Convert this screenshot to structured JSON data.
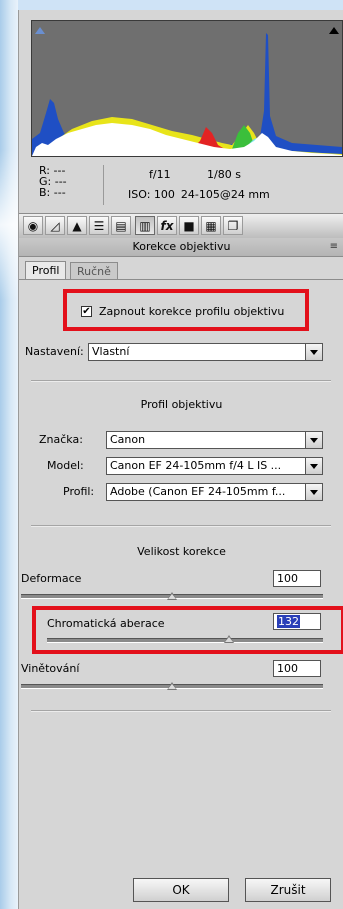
{
  "histogram": {
    "clip_shadow_icon": "triangle-up-icon",
    "clip_highlight_icon": "triangle-up-icon"
  },
  "info": {
    "r": "R:  ---",
    "g": "G:  ---",
    "b": "B:  ---",
    "aperture": "f/11",
    "shutter": "1/80 s",
    "iso": "ISO: 100",
    "lens": "24-105@24 mm"
  },
  "toolbar": {
    "tools": [
      "basic-icon",
      "tone-curve-icon",
      "detail-icon",
      "hsl-icon",
      "split-toning-icon",
      "lens-corrections-icon",
      "effects-icon",
      "camera-calibration-icon",
      "presets-icon",
      "snapshots-icon"
    ]
  },
  "panel": {
    "title": "Korekce objektivu",
    "menu_icon": "≡",
    "tabs": [
      "Profil",
      "Ručně"
    ]
  },
  "profile_enable": {
    "label": "Zapnout korekce profilu objektivu",
    "checked": true,
    "check_glyph": "✔"
  },
  "setting": {
    "label": "Nastavení:",
    "value": "Vlastní"
  },
  "lens_profile": {
    "heading": "Profil objektivu",
    "make_label": "Značka:",
    "make_value": "Canon",
    "model_label": "Model:",
    "model_value": "Canon EF 24-105mm f/4 L IS ...",
    "profile_label": "Profil:",
    "profile_value": "Adobe (Canon EF 24-105mm f..."
  },
  "correction": {
    "heading": "Velikost korekce",
    "distortion_label": "Deformace",
    "distortion_value": "100",
    "distortion_fraction": 0.5,
    "ca_label": "Chromatická aberace",
    "ca_value": "132",
    "ca_fraction": 0.66,
    "vignette_label": "Vinětování",
    "vignette_value": "100",
    "vignette_fraction": 0.5
  },
  "buttons": {
    "ok": "OK",
    "cancel": "Zrušit"
  },
  "colors": {
    "highlight_red": "#e3101b",
    "selection_blue": "#2a3fb8"
  }
}
